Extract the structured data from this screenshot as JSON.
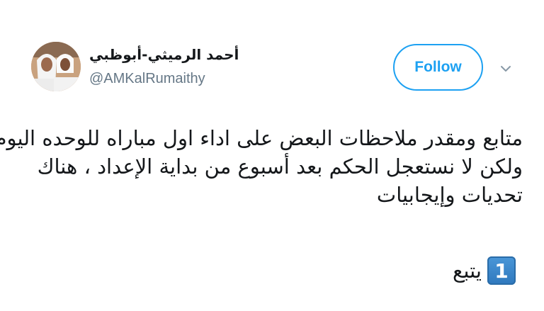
{
  "user": {
    "display_name": "أحمد الرميثي-أبوظبي",
    "handle": "@AMKalRumaithy"
  },
  "actions": {
    "follow_label": "Follow",
    "menu_icon": "chevron-down-icon"
  },
  "tweet": {
    "lines": [
      "متابع ومقدر ملاحظات البعض على اداء اول مباراه للوحده اليوم",
      "ولكن لا نستعجل الحكم بعد أسبوع من بداية الإعداد ، هناك",
      "تحديات وإيجابيات"
    ],
    "continuation_text": "يتبع",
    "keycap_number": "1"
  },
  "colors": {
    "accent": "#1da1f2",
    "handle_gray": "#657786",
    "text": "#14171a",
    "keycap_blue": "#3a86c8"
  }
}
